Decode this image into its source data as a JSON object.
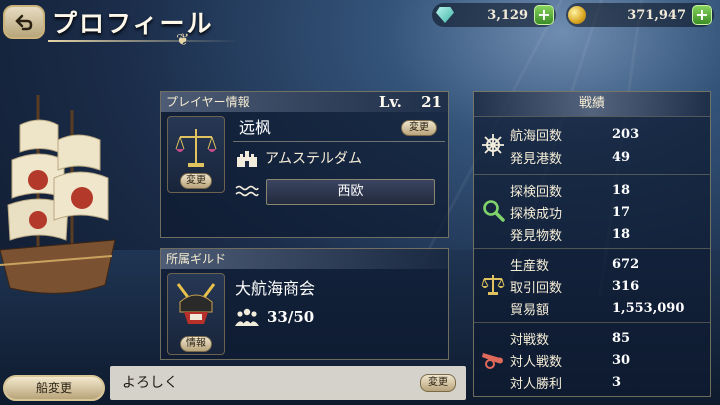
{
  "header": {
    "back_icon": "back-arrow-icon",
    "title": "プロフィール"
  },
  "currency": {
    "gems": "3,129",
    "gold": "371,947",
    "plus_label": "+"
  },
  "player": {
    "section_title": "プレイヤー情報",
    "level_label": "Lv.",
    "level": "21",
    "name": "远枫",
    "change_label": "変更",
    "emblem_change_label": "変更",
    "home_port": "アムステルダム",
    "region": "西欧"
  },
  "guild": {
    "section_title": "所属ギルド",
    "name": "大航海商会",
    "members": "33/50",
    "info_label": "情報"
  },
  "ship_change_label": "船変更",
  "comment": {
    "text": "よろしく",
    "change_label": "変更"
  },
  "record": {
    "title": "戦績",
    "groups": [
      {
        "icon": "ship-wheel-icon",
        "rows": [
          {
            "label": "航海回数",
            "value": "203"
          },
          {
            "label": "発見港数",
            "value": "49"
          }
        ]
      },
      {
        "icon": "magnifier-icon",
        "rows": [
          {
            "label": "探検回数",
            "value": "18"
          },
          {
            "label": "探検成功",
            "value": "17"
          },
          {
            "label": "発見物数",
            "value": "18"
          }
        ]
      },
      {
        "icon": "scales-icon",
        "rows": [
          {
            "label": "生産数",
            "value": "672"
          },
          {
            "label": "取引回数",
            "value": "316"
          },
          {
            "label": "貿易額",
            "value": "1,553,090"
          }
        ]
      },
      {
        "icon": "cannon-icon",
        "rows": [
          {
            "label": "対戦数",
            "value": "85"
          },
          {
            "label": "対人戦数",
            "value": "30"
          },
          {
            "label": "対人勝利",
            "value": "3"
          }
        ]
      }
    ]
  }
}
